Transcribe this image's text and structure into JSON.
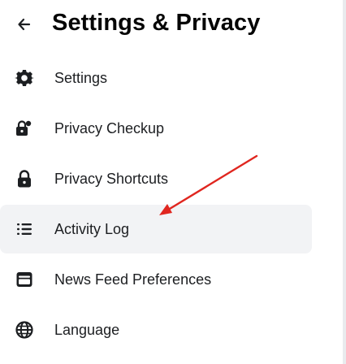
{
  "header": {
    "title": "Settings & Privacy",
    "back_icon": "arrow-left-icon"
  },
  "menu": {
    "items": [
      {
        "label": "Settings",
        "icon": "gear-icon",
        "active": false
      },
      {
        "label": "Privacy Checkup",
        "icon": "lock-person-icon",
        "active": false
      },
      {
        "label": "Privacy Shortcuts",
        "icon": "lock-icon",
        "active": false
      },
      {
        "label": "Activity Log",
        "icon": "list-icon",
        "active": true
      },
      {
        "label": "News Feed Preferences",
        "icon": "news-feed-icon",
        "active": false
      },
      {
        "label": "Language",
        "icon": "globe-icon",
        "active": false
      }
    ]
  },
  "annotation": {
    "arrow_color": "#e0261f"
  },
  "colors": {
    "text": "#050505",
    "active_bg": "#f2f3f5",
    "icon": "#1c1e21"
  }
}
